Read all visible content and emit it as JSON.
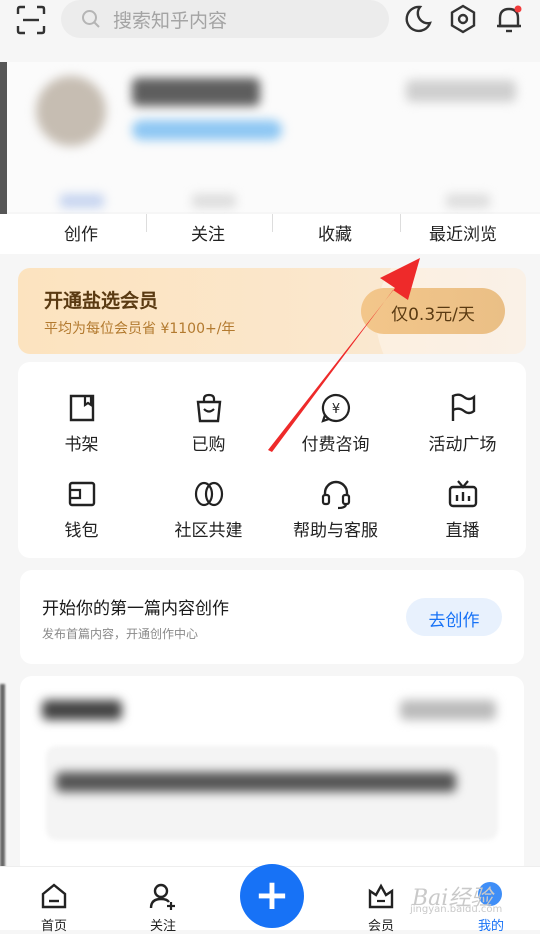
{
  "search": {
    "placeholder": "搜索知乎内容"
  },
  "stats": [
    "创作",
    "关注",
    "收藏",
    "最近浏览"
  ],
  "vip": {
    "title": "开通盐选会员",
    "subtitle": "平均为每位会员省 ¥1100+/年",
    "button": "仅0.3元/天"
  },
  "grid": [
    {
      "label": "书架",
      "icon": "bookshelf-icon"
    },
    {
      "label": "已购",
      "icon": "shopping-bag-icon"
    },
    {
      "label": "付费咨询",
      "icon": "paid-consult-icon"
    },
    {
      "label": "活动广场",
      "icon": "flag-icon"
    },
    {
      "label": "钱包",
      "icon": "wallet-icon"
    },
    {
      "label": "社区共建",
      "icon": "community-icon"
    },
    {
      "label": "帮助与客服",
      "icon": "headset-icon"
    },
    {
      "label": "直播",
      "icon": "live-tv-icon"
    }
  ],
  "create": {
    "title": "开始你的第一篇内容创作",
    "subtitle": "发布首篇内容，开通创作中心",
    "button": "去创作"
  },
  "tabs": [
    {
      "label": "首页",
      "icon": "home-icon"
    },
    {
      "label": "关注",
      "icon": "follow-icon"
    },
    {
      "label": "会员",
      "icon": "vip-icon"
    },
    {
      "label": "我的",
      "icon": "me-icon"
    }
  ],
  "watermark": {
    "main": "Bai经验",
    "sub": "jingyan.baidu.com"
  },
  "colors": {
    "accent": "#1772f6",
    "annotation_arrow": "#ee2a2a",
    "vip_text": "#5a3a12"
  }
}
